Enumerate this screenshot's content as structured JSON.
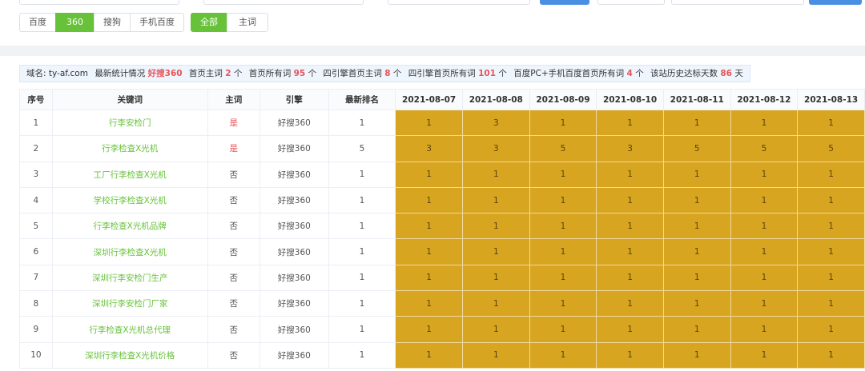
{
  "engine_tabs": [
    {
      "label": "百度",
      "active": false
    },
    {
      "label": "360",
      "active": true
    },
    {
      "label": "搜狗",
      "active": false
    },
    {
      "label": "手机百度",
      "active": false
    }
  ],
  "filter_tabs": [
    {
      "label": "全部",
      "active": true
    },
    {
      "label": "主词",
      "active": false
    }
  ],
  "summary": {
    "domain_label": "域名:",
    "domain": "ty-af.com",
    "latest_label": "最新统计情况",
    "engine_name": "好搜360",
    "home_main_label": "首页主词",
    "home_main_value": "2",
    "home_all_label": "首页所有词",
    "home_all_value": "95",
    "four_main_label": "四引擎首页主词",
    "four_main_value": "8",
    "four_all_label": "四引擎首页所有词",
    "four_all_value": "101",
    "pc_mobile_label": "百度PC+手机百度首页所有词",
    "pc_mobile_value": "4",
    "history_label": "该站历史达标天数",
    "history_value": "86",
    "unit_ge": "个",
    "unit_day": "天"
  },
  "table": {
    "headers": [
      "序号",
      "关键词",
      "主词",
      "引擎",
      "最新排名",
      "2021-08-07",
      "2021-08-08",
      "2021-08-09",
      "2021-08-10",
      "2021-08-11",
      "2021-08-12",
      "2021-08-13"
    ],
    "rows": [
      {
        "no": "1",
        "keyword": "行李安检门",
        "main": "是",
        "engine": "好搜360",
        "latest": "1",
        "ranks": [
          "1",
          "3",
          "1",
          "1",
          "1",
          "1",
          "1"
        ]
      },
      {
        "no": "2",
        "keyword": "行李检查X光机",
        "main": "是",
        "engine": "好搜360",
        "latest": "5",
        "ranks": [
          "3",
          "3",
          "5",
          "3",
          "5",
          "5",
          "5"
        ]
      },
      {
        "no": "3",
        "keyword": "工厂行李检查X光机",
        "main": "否",
        "engine": "好搜360",
        "latest": "1",
        "ranks": [
          "1",
          "1",
          "1",
          "1",
          "1",
          "1",
          "1"
        ]
      },
      {
        "no": "4",
        "keyword": "学校行李检查X光机",
        "main": "否",
        "engine": "好搜360",
        "latest": "1",
        "ranks": [
          "1",
          "1",
          "1",
          "1",
          "1",
          "1",
          "1"
        ]
      },
      {
        "no": "5",
        "keyword": "行李检查X光机品牌",
        "main": "否",
        "engine": "好搜360",
        "latest": "1",
        "ranks": [
          "1",
          "1",
          "1",
          "1",
          "1",
          "1",
          "1"
        ]
      },
      {
        "no": "6",
        "keyword": "深圳行李检查X光机",
        "main": "否",
        "engine": "好搜360",
        "latest": "1",
        "ranks": [
          "1",
          "1",
          "1",
          "1",
          "1",
          "1",
          "1"
        ]
      },
      {
        "no": "7",
        "keyword": "深圳行李安检门生产",
        "main": "否",
        "engine": "好搜360",
        "latest": "1",
        "ranks": [
          "1",
          "1",
          "1",
          "1",
          "1",
          "1",
          "1"
        ]
      },
      {
        "no": "8",
        "keyword": "深圳行李安检门厂家",
        "main": "否",
        "engine": "好搜360",
        "latest": "1",
        "ranks": [
          "1",
          "1",
          "1",
          "1",
          "1",
          "1",
          "1"
        ]
      },
      {
        "no": "9",
        "keyword": "行李检查X光机总代理",
        "main": "否",
        "engine": "好搜360",
        "latest": "1",
        "ranks": [
          "1",
          "1",
          "1",
          "1",
          "1",
          "1",
          "1"
        ]
      },
      {
        "no": "10",
        "keyword": "深圳行李检查X光机价格",
        "main": "否",
        "engine": "好搜360",
        "latest": "1",
        "ranks": [
          "1",
          "1",
          "1",
          "1",
          "1",
          "1",
          "1"
        ]
      }
    ]
  }
}
